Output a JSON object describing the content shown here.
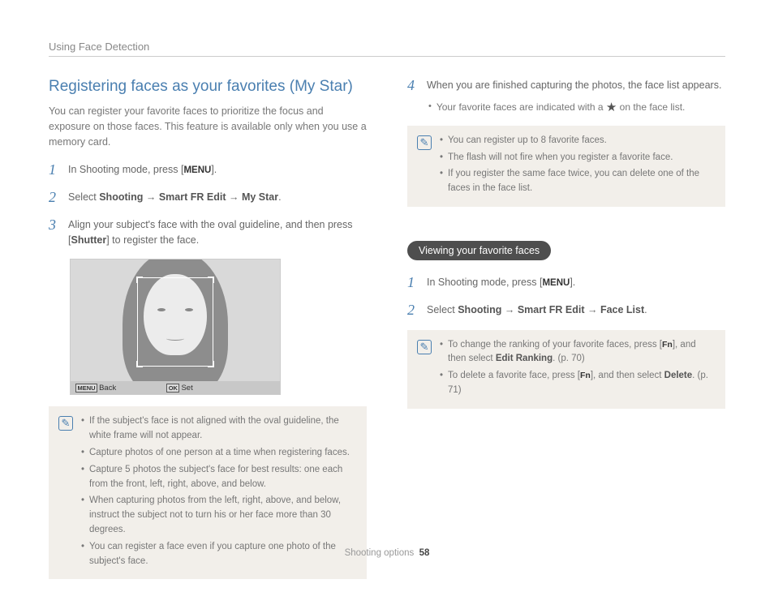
{
  "header": {
    "section": "Using Face Detection"
  },
  "left": {
    "heading": "Registering faces as your favorites (My Star)",
    "intro": "You can register your favorite faces to prioritize the focus and exposure on those faces. This feature is available only when you use a memory card.",
    "step1_a": "In Shooting mode, press [",
    "step1_menu": "MENU",
    "step1_b": "].",
    "step2_a": "Select ",
    "step2_b": "Shooting",
    "step2_c": " → ",
    "step2_d": "Smart FR Edit",
    "step2_e": " → ",
    "step2_f": "My Star",
    "step2_g": ".",
    "step3_a": "Align your subject's face with the oval guideline, and then press [",
    "step3_b": "Shutter",
    "step3_c": "] to register the face.",
    "cam": {
      "back_key": "MENU",
      "back": "Back",
      "set_key": "OK",
      "set": "Set"
    },
    "notes": [
      "If the subject's face is not aligned with the oval guideline, the white frame will not appear.",
      "Capture photos of one person at a time when registering faces.",
      "Capture 5 photos the subject's face for best results: one each from the front, left, right, above, and below.",
      "When capturing photos from the left, right, above, and below, instruct the subject not to turn his or her face more than 30 degrees.",
      "You can register a face even if you capture one photo of the subject's face."
    ]
  },
  "right": {
    "step4_a": "When you are finished capturing the photos, the face list appears.",
    "step4_sub_a": "Your favorite faces are indicated with a ",
    "step4_sub_b": " on the face list.",
    "notes1": [
      "You can register up to 8 favorite faces.",
      "The flash will not fire when you register a favorite face.",
      "If you register the same face twice, you can delete one of the faces in the face list."
    ],
    "pill": "Viewing your favorite faces",
    "vstep1_a": "In Shooting mode, press [",
    "vstep1_menu": "MENU",
    "vstep1_b": "].",
    "vstep2_a": "Select ",
    "vstep2_b": "Shooting",
    "vstep2_c": " → ",
    "vstep2_d": "Smart FR Edit",
    "vstep2_e": " → ",
    "vstep2_f": "Face List",
    "vstep2_g": ".",
    "note2_1a": "To change the ranking of your favorite faces, press [",
    "note2_1fn": "Fn",
    "note2_1b": "], and then select ",
    "note2_1c": "Edit Ranking",
    "note2_1d": ". (p. 70)",
    "note2_2a": "To delete a favorite face, press [",
    "note2_2fn": "Fn",
    "note2_2b": "], and then select ",
    "note2_2c": "Delete",
    "note2_2d": ". (p. 71)"
  },
  "footer": {
    "section": "Shooting options",
    "page": "58"
  }
}
